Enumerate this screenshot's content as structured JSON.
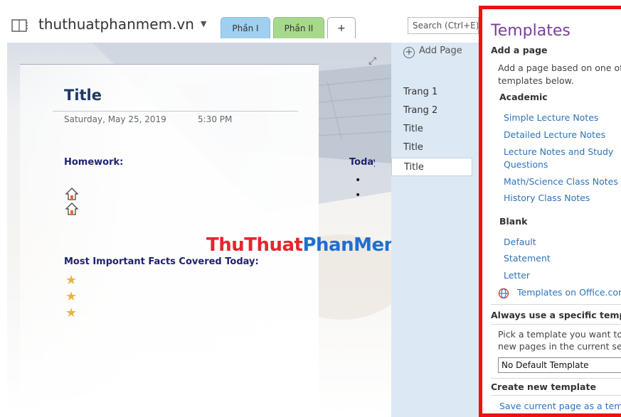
{
  "notebook": {
    "title": "thuthuatphanmem.vn"
  },
  "sections": {
    "tabs": [
      {
        "label": "Phần I",
        "color": "#9fd0f0"
      },
      {
        "label": "Phần II",
        "color": "#a7d98c"
      }
    ],
    "add_tab_label": "+"
  },
  "search": {
    "placeholder": "Search (Ctrl+E)"
  },
  "page": {
    "title": "Title",
    "date": "Saturday, May 25, 2019",
    "time": "5:30 PM",
    "homework_heading": "Homework:",
    "today_heading": "Today",
    "facts_heading": "Most Important Facts Covered Today:",
    "bullet_glyph": "•"
  },
  "watermark": {
    "part1": "ThuThuat",
    "part2": "PhanMem.vn"
  },
  "page_list": {
    "add_page_label": "Add Page",
    "items": [
      {
        "label": "Trang 1"
      },
      {
        "label": "Trang 2"
      },
      {
        "label": "Title"
      },
      {
        "label": "Title"
      },
      {
        "label": "Title",
        "selected": true
      }
    ]
  },
  "templates_pane": {
    "title": "Templates",
    "add_page_heading": "Add a page",
    "add_page_desc_1": "Add a page based on one of the",
    "add_page_desc_2": "templates below.",
    "academic_heading": "Academic",
    "academic_items": [
      "Simple Lecture Notes",
      "Detailed Lecture Notes",
      "Lecture Notes and Study",
      "Questions",
      "Math/Science Class Notes",
      "History Class Notes"
    ],
    "blank_heading": "Blank",
    "blank_items": [
      "Default",
      "Statement",
      "Letter"
    ],
    "office_link": "Templates on Office.com",
    "always_heading": "Always use a specific template",
    "always_desc_1": "Pick a template you want to use for all",
    "always_desc_2": "new pages in the current section.",
    "default_template_value": "No Default Template",
    "create_heading": "Create new template",
    "save_link": "Save current page as a template",
    "border_color": "#ee1111"
  }
}
